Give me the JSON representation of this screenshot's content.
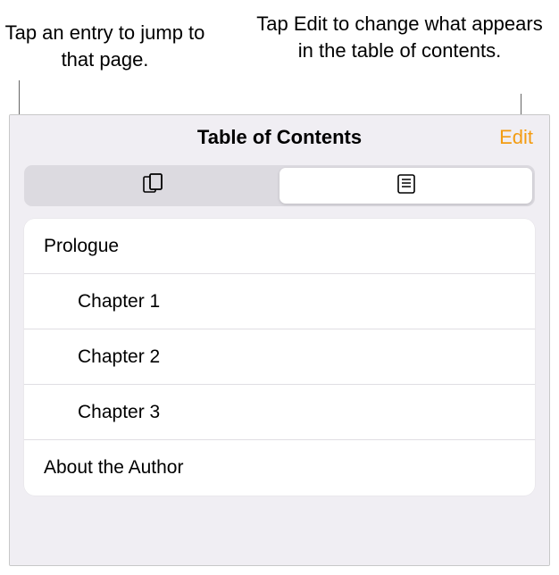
{
  "callouts": {
    "left": "Tap an entry to jump to that page.",
    "right": "Tap Edit to change what appears in the table of contents."
  },
  "panel": {
    "title": "Table of Contents",
    "edit_label": "Edit",
    "segments": {
      "thumbnails_icon": "pages-thumbnails-icon",
      "list_icon": "toc-list-icon"
    },
    "entries": [
      {
        "label": "Prologue",
        "level": 0
      },
      {
        "label": "Chapter 1",
        "level": 1
      },
      {
        "label": "Chapter 2",
        "level": 1
      },
      {
        "label": "Chapter 3",
        "level": 1
      },
      {
        "label": "About the Author",
        "level": 0
      }
    ]
  },
  "colors": {
    "accent": "#f39c12",
    "panel_bg": "#f0eef3",
    "segment_bg": "#dcdae0"
  }
}
